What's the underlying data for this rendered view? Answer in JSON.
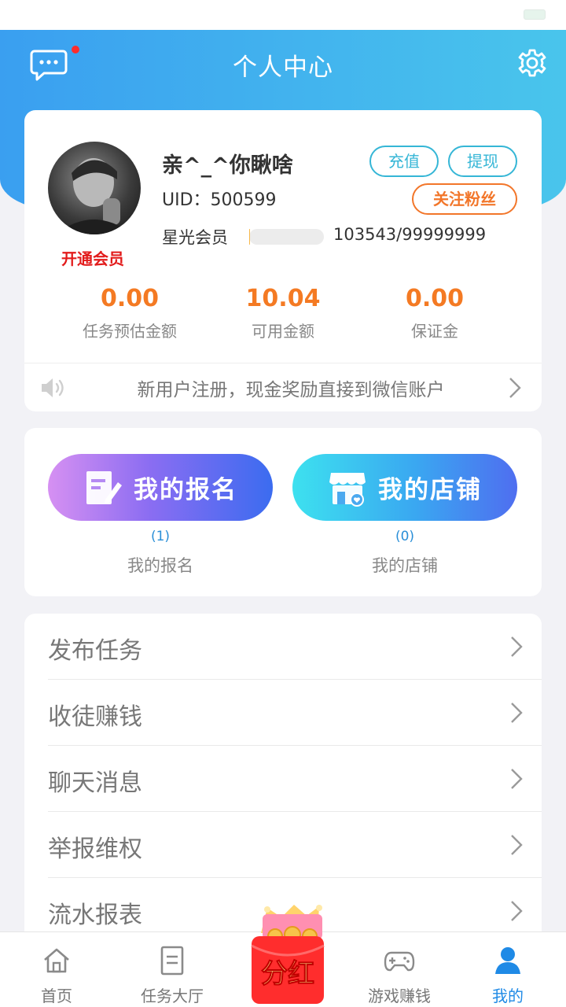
{
  "header": {
    "title": "个人中心"
  },
  "profile": {
    "nickname": "亲^_^你瞅啥",
    "uid": "UID：500599",
    "level_name": "星光会员",
    "level_progress": 0.001,
    "level_value": "103543/99999999",
    "vip_link": "开通会员",
    "recharge_label": "充值",
    "withdraw_label": "提现",
    "follow_label": "关注粉丝"
  },
  "stats": [
    {
      "value": "0.00",
      "label": "任务预估金额"
    },
    {
      "value": "10.04",
      "label": "可用金额"
    },
    {
      "value": "0.00",
      "label": "保证金"
    }
  ],
  "notice": "新用户注册，现金奖励直接到微信账户",
  "quick": {
    "signup": {
      "button": "我的报名",
      "count": "(1)",
      "label": "我的报名"
    },
    "shop": {
      "button": "我的店铺",
      "count": "(0)",
      "label": "我的店铺"
    }
  },
  "menu": [
    "发布任务",
    "收徒赚钱",
    "聊天消息",
    "举报维权",
    "流水报表"
  ],
  "tabs": [
    "首页",
    "任务大厅",
    "游戏赚钱",
    "我的"
  ],
  "center_tab_label": "分红",
  "colors": {
    "accent": "#1f8ae6",
    "orange": "#f47a23",
    "header_start": "#3a9ff0",
    "header_end": "#49c5ec"
  },
  "icons": [
    "message-icon",
    "gear-icon",
    "speaker-icon",
    "form-icon",
    "shop-icon",
    "home-icon",
    "task-list-icon",
    "gamepad-icon",
    "user-icon",
    "red-packet-icon"
  ]
}
